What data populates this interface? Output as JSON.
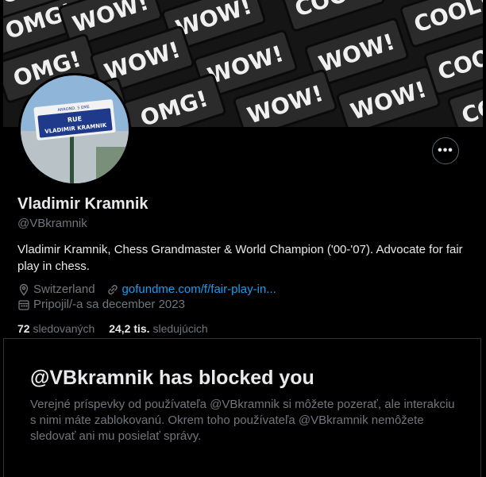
{
  "banner": {
    "words": [
      "OMG!",
      "WOW!",
      "WOW!",
      "COOL!",
      "COOL!",
      "OMG!",
      "WOW!",
      "WOW!",
      "WOW!",
      "COOL!",
      "COOL!",
      "OMG!",
      "WOW!",
      "WOW!",
      "COOL!",
      "COOL!"
    ]
  },
  "avatar": {
    "sign_top": "ARROND. 5 EME",
    "sign_line1": "RUE",
    "sign_line2": "VLADIMIR KRAMNIK"
  },
  "profile": {
    "name": "Vladimir Kramnik",
    "handle": "@VBkramnik",
    "bio": "Vladimir Kramnik, Chess Grandmaster & World Champion ('00-'07). Advocate for fair play in chess.",
    "location": "Switzerland",
    "link": "gofundme.com/f/fair-play-in...",
    "joined": "Pripojil/-a sa december 2023",
    "following_count": "72",
    "following_label": "sledovaných",
    "followers_count": "24,2 tis.",
    "followers_label": "sledujúcich"
  },
  "more_button": {
    "label": "•••"
  },
  "blocked": {
    "title": "@VBkramnik has blocked you",
    "text": "Verejné príspevky od používateľa @VBkramnik si môžete pozerať, ale interakciu s nimi máte zablokovanú. Okrem toho používateľa @VBkramnik nemôžete sledovať ani mu posielať správy."
  },
  "colors": {
    "background": "#000000",
    "text": "#e7e9ea",
    "secondary": "#71767b",
    "link": "#1d9bf0",
    "border": "#2f3336"
  }
}
